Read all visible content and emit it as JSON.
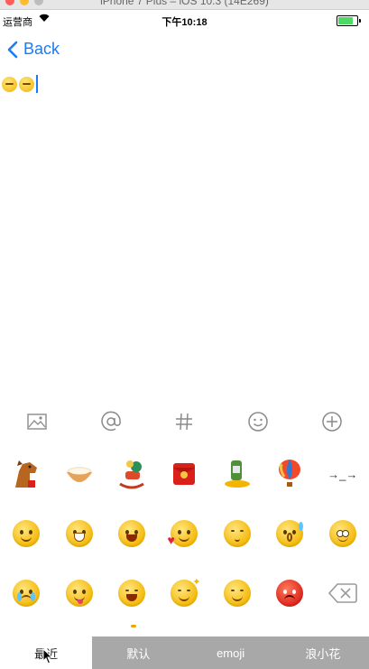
{
  "simulator": {
    "title": "iPhone 7 Plus – iOS 10.3 (14E269)"
  },
  "status_bar": {
    "carrier": "运营商",
    "time": "下午10:18",
    "battery_level": 0.9,
    "battery_color": "#4cd964"
  },
  "nav": {
    "back_label": "Back",
    "accent_color": "#1a7cf5"
  },
  "input": {
    "emoji_count": 2
  },
  "toolbar": {
    "icons": [
      "image-icon",
      "at-sign-icon",
      "hashtag-icon",
      "smiley-icon",
      "add-icon"
    ]
  },
  "emoji_grid": {
    "rows": [
      [
        "horse-emoji",
        "bowl-emoji",
        "rocking-horse-emoji",
        "red-envelope-emoji",
        "beer-emoji",
        "hot-air-balloon-emoji",
        "→_→"
      ],
      [
        "smile-emoji",
        "grin-emoji",
        "laugh-emoji",
        "blush-heart-emoji",
        "shy-emoji",
        "sweat-emoji",
        "confused-emoji"
      ],
      [
        "crying-emoji",
        "tongue-emoji",
        "distressed-emoji",
        "sparkle-emoji",
        "happy-emoji",
        "angry-emoji",
        "delete-key"
      ]
    ],
    "text_emoticon": "→_→"
  },
  "bottom_tabs": [
    "最近",
    "默认",
    "emoji",
    "浪小花"
  ],
  "active_tab_index": 0
}
